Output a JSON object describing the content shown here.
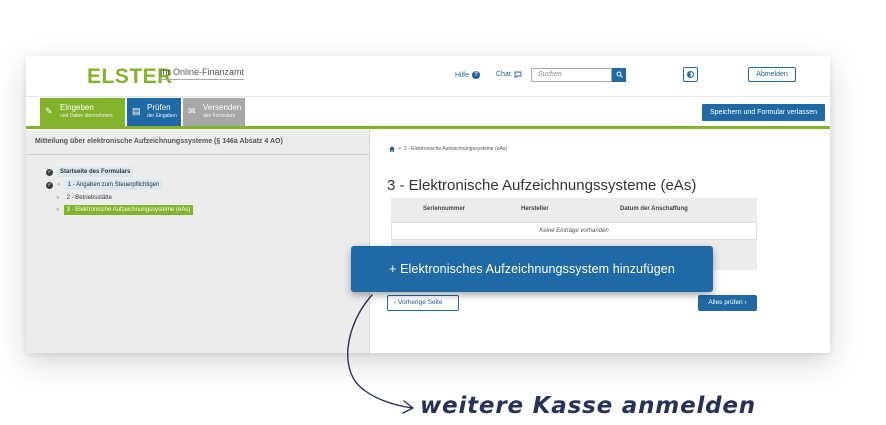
{
  "header": {
    "logo": "ELSTER",
    "logo_sub": "Ihr Online-Finanzamt",
    "help_label": "Hilfe",
    "chat_label": "Chat",
    "search_placeholder": "Suchen",
    "logout_label": "Abmelden"
  },
  "steps": [
    {
      "label": "Eingeben",
      "sub": "und Daten übernehmen",
      "icon": "edit-icon",
      "color": "#82b32a"
    },
    {
      "label": "Prüfen",
      "sub": "der Eingaben",
      "icon": "clipboard-icon",
      "color": "#1f6aa5"
    },
    {
      "label": "Versenden",
      "sub": "des Formulars",
      "icon": "send-icon",
      "color": "#a7a7a7"
    }
  ],
  "save_button": "Speichern und Formular verlassen",
  "left_panel": {
    "title": "Mitteilung über elektronische Aufzeichnungssysteme (§ 146a Absatz 4 AO)",
    "items": [
      {
        "label": "Startseite des Formulars"
      },
      {
        "label": "1 - Angaben zum Steuerpflichtigen"
      },
      {
        "label": "2 - Betriebsstätte"
      },
      {
        "label": "3 - Elektronische Aufzeichnungssysteme (eAs)"
      }
    ]
  },
  "breadcrumb": "3 - Elektronische Aufzeichnungssysteme (eAs)",
  "page_title": "3 - Elektronische Aufzeichnungssysteme (eAs)",
  "table": {
    "headers": [
      "Seriennummer",
      "Hersteller",
      "Datum der Anschaffung"
    ],
    "empty_text": "Keine Einträge vorhanden"
  },
  "add_button": "+ Elektronisches Aufzeichnungssystem hinzufügen",
  "prev_button": "Vorherige Seite",
  "check_all_button": "Alles prüfen",
  "annotation": "weitere Kasse anmelden",
  "colors": {
    "brand_green": "#82b32a",
    "brand_blue": "#1f6aa5",
    "annotation": "#27325a"
  }
}
